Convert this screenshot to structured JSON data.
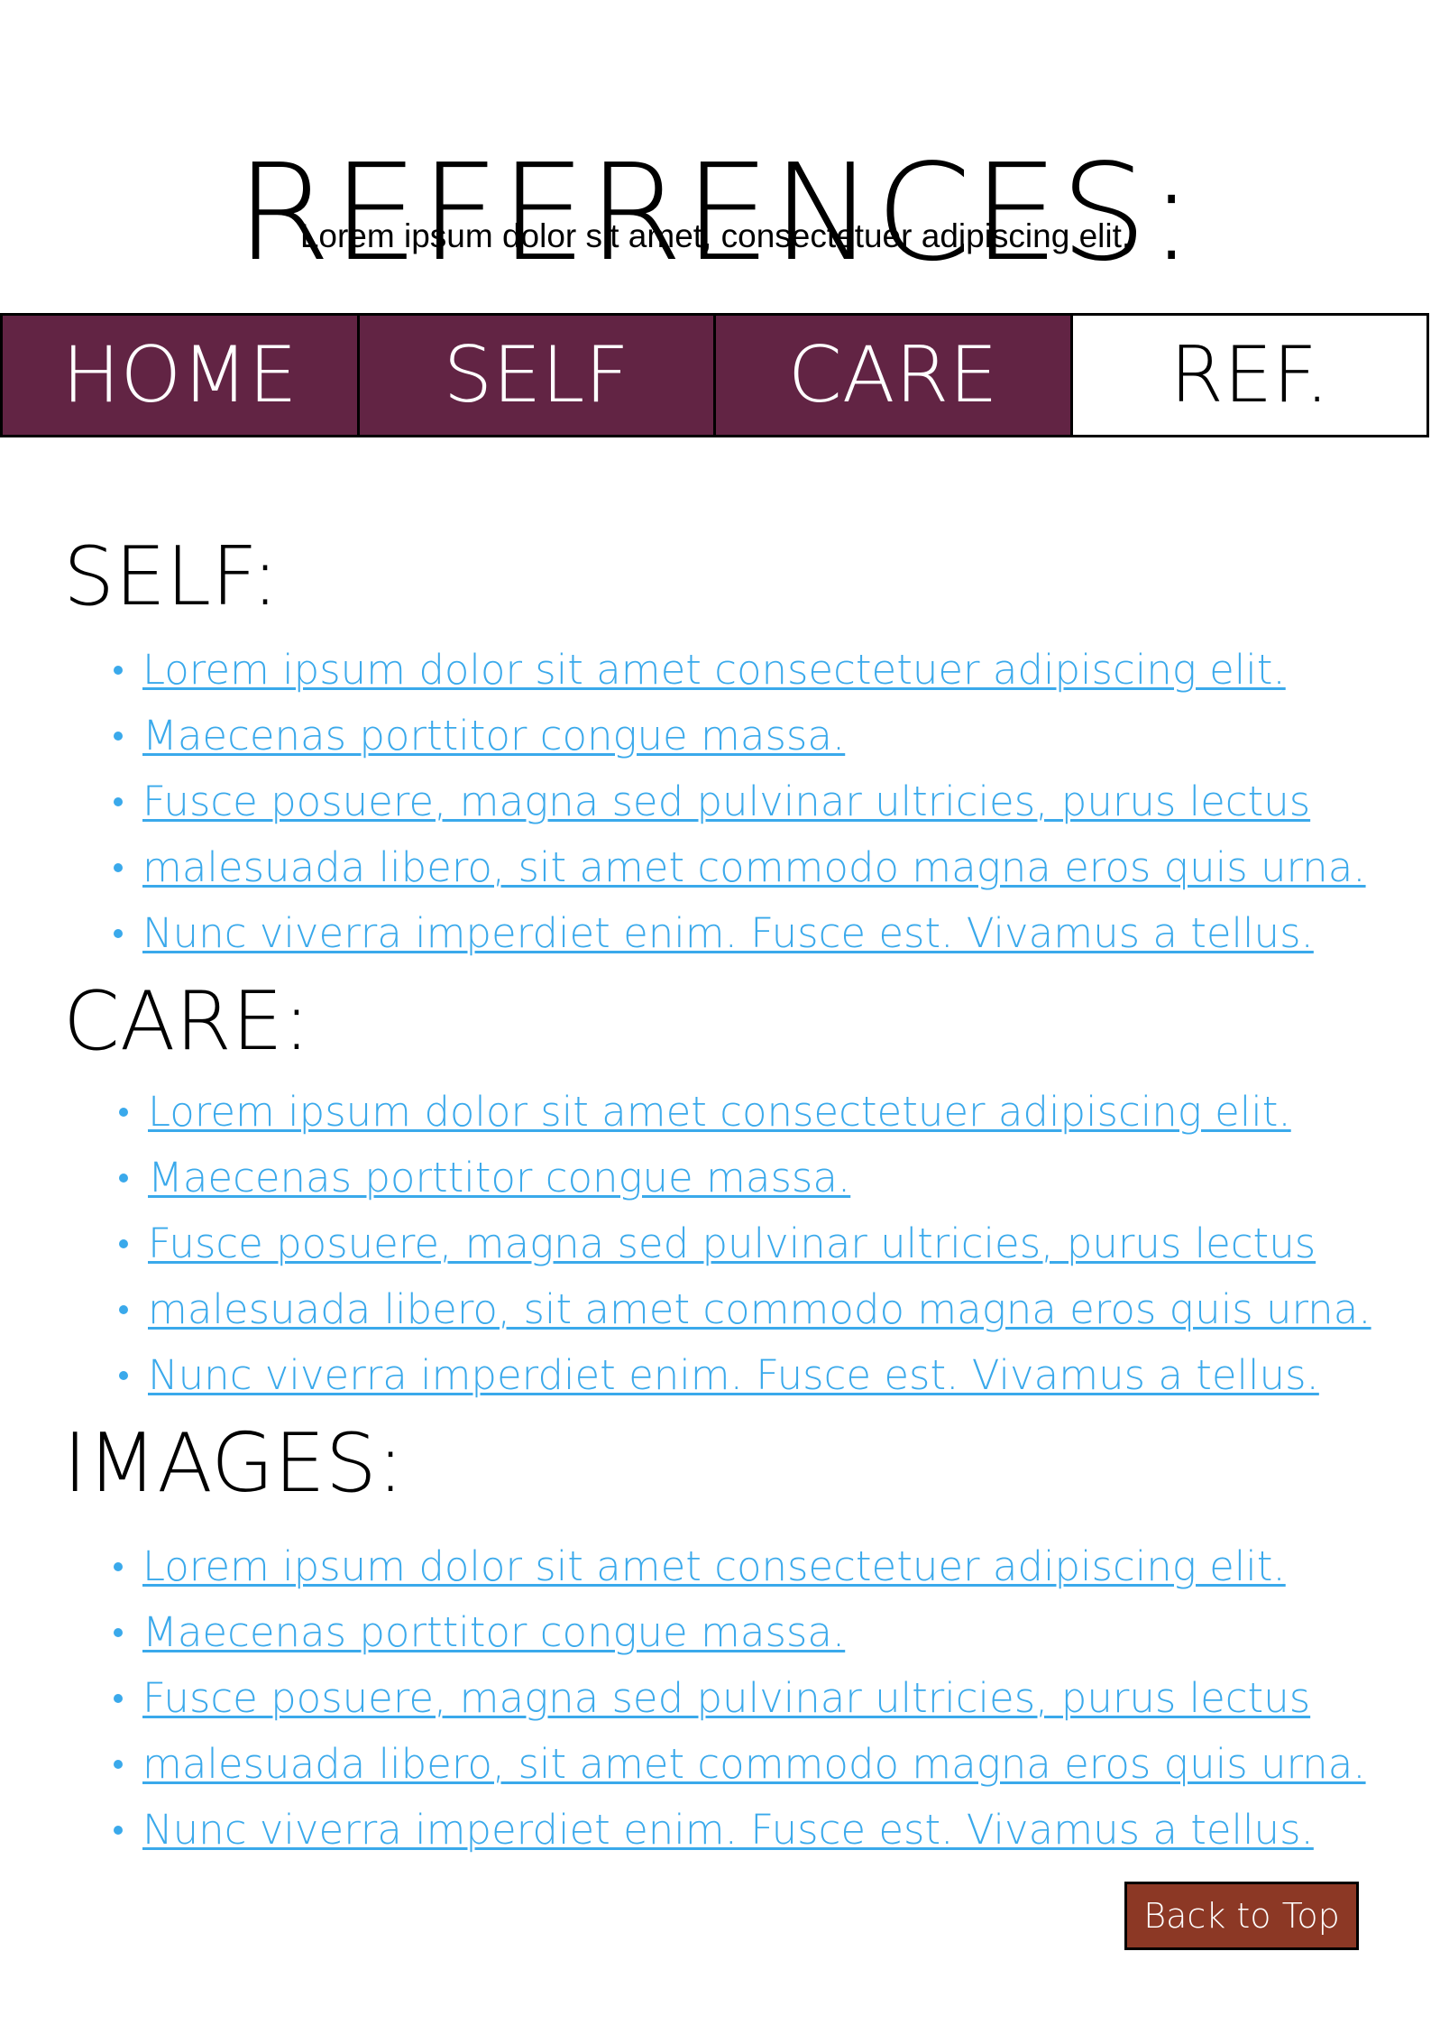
{
  "header": {
    "title": "REFERENCES:",
    "subtitle": "Lorem ipsum dolor sit amet, consectetuer adipiscing elit."
  },
  "nav": {
    "tabs": [
      {
        "label": "HOME",
        "active": false
      },
      {
        "label": "SELF",
        "active": false
      },
      {
        "label": "CARE",
        "active": false
      },
      {
        "label": "REF.",
        "active": true
      }
    ]
  },
  "sections": [
    {
      "heading": "SELF:",
      "links": [
        "Lorem ipsum dolor sit amet consectetuer adipiscing elit.",
        "Maecenas porttitor congue massa.",
        "Fusce posuere, magna sed pulvinar ultricies, purus lectus",
        "malesuada libero, sit amet commodo magna eros quis urna.",
        "Nunc viverra imperdiet enim. Fusce est. Vivamus a tellus."
      ]
    },
    {
      "heading": "CARE:",
      "links": [
        "Lorem ipsum dolor sit amet consectetuer adipiscing elit.",
        "Maecenas porttitor congue massa.",
        "Fusce posuere, magna sed pulvinar ultricies, purus lectus",
        "malesuada libero, sit amet commodo magna eros quis urna.",
        "Nunc viverra imperdiet enim. Fusce est. Vivamus a tellus."
      ]
    },
    {
      "heading": "IMAGES:",
      "links": [
        "Lorem ipsum dolor sit amet consectetuer adipiscing elit.",
        "Maecenas porttitor congue massa.",
        "Fusce posuere, magna sed pulvinar ultricies, purus lectus",
        "malesuada libero, sit amet commodo magna eros quis urna.",
        "Nunc viverra imperdiet enim. Fusce est. Vivamus a tellus."
      ]
    }
  ],
  "footer": {
    "back_to_top_label": "Back to Top"
  },
  "colors": {
    "nav_background": "#622444",
    "link": "#3aa9eb",
    "back_to_top_background": "#8c3825"
  }
}
